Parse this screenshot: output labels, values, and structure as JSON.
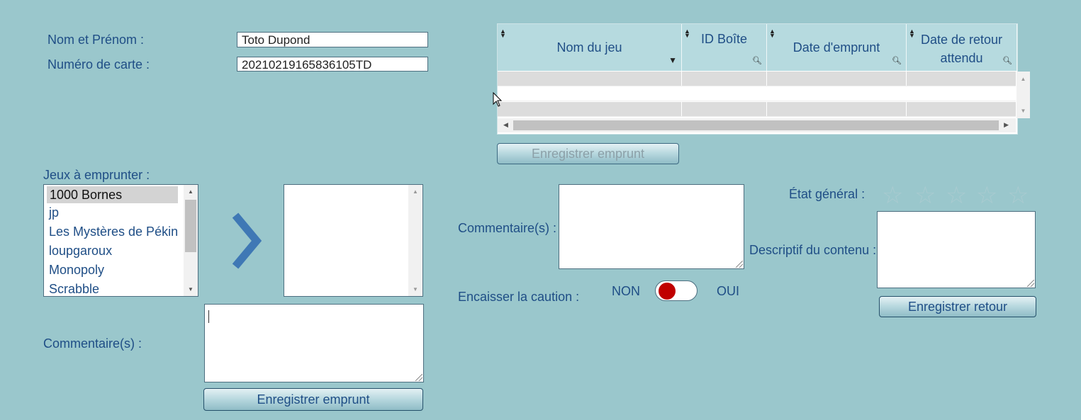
{
  "identity": {
    "name_label": "Nom et Prénom :",
    "name_value": "Toto Dupond",
    "card_label": "Numéro de carte :",
    "card_value": "20210219165836105TD"
  },
  "loans_table": {
    "columns": [
      "Nom du jeu",
      "ID Boîte",
      "Date d'emprunt",
      "Date de retour attendu"
    ],
    "rows": [
      [
        "",
        "",
        "",
        ""
      ],
      [
        "",
        "",
        "",
        ""
      ],
      [
        "",
        "",
        "",
        ""
      ]
    ],
    "button_label": "Enregistrer emprunt"
  },
  "borrow": {
    "games_label": "Jeux à emprunter :",
    "games": [
      "1000 Bornes",
      "jp",
      "Les Mystères de Pékin",
      "loupgaroux",
      "Monopoly",
      "Scrabble"
    ],
    "selected_game": "1000 Bornes",
    "comment_label": "Commentaire(s) :",
    "comment_value": "",
    "button_label": "Enregistrer emprunt"
  },
  "return": {
    "comment_label": "Commentaire(s) :",
    "caution_label": "Encaisser la caution :",
    "toggle_off_label": "NON",
    "toggle_on_label": "OUI",
    "toggle_state": "NON",
    "state_label": "État général :",
    "rating": 0,
    "rating_max": 5,
    "content_label": "Descriptif du contenu :",
    "button_label": "Enregistrer retour"
  },
  "colors": {
    "background": "#9ac7cc",
    "text": "#1f4e86",
    "header": "#b6dadf",
    "toggle_knob": "#c00000"
  }
}
